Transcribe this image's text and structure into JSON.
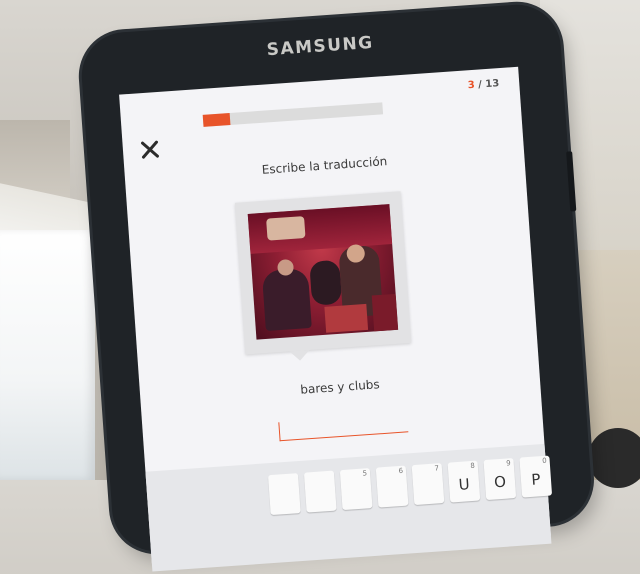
{
  "phone": {
    "brand": "SAMSUNG"
  },
  "lesson": {
    "counter_current": "3",
    "counter_sep": " / ",
    "counter_total": "13",
    "progress_fraction": 0.15,
    "prompt": "Escribe la traducción",
    "answer_text": "bares y clubs",
    "input_value": ""
  },
  "icons": {
    "close": "close-icon"
  },
  "colors": {
    "accent": "#e8542a",
    "screen_bg": "#f4f4f7",
    "phone_body": "#1f2327"
  },
  "keyboard": {
    "keys": [
      {
        "num": "",
        "letter": ""
      },
      {
        "num": "",
        "letter": ""
      },
      {
        "num": "5",
        "letter": ""
      },
      {
        "num": "6",
        "letter": ""
      },
      {
        "num": "7",
        "letter": ""
      },
      {
        "num": "8",
        "letter": "U"
      },
      {
        "num": "9",
        "letter": "O"
      },
      {
        "num": "0",
        "letter": "P"
      }
    ]
  }
}
